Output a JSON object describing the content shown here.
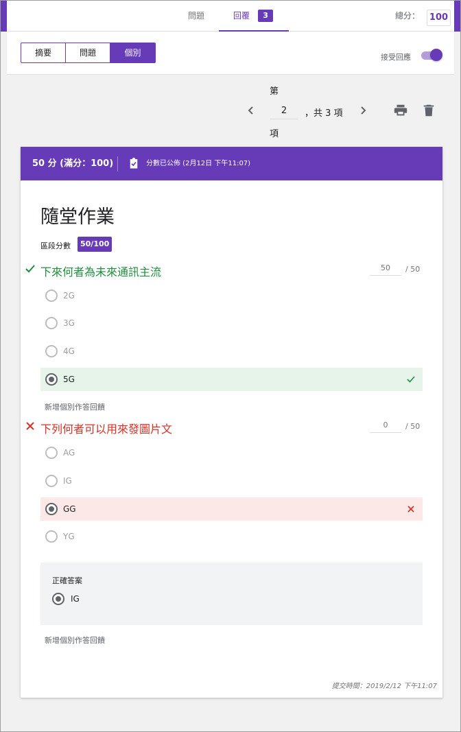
{
  "header": {
    "tabs": [
      {
        "label": "問題"
      },
      {
        "label": "回覆",
        "count": "3"
      }
    ],
    "total_label": "總分：",
    "total_value": "100"
  },
  "controls": {
    "segments": [
      "摘要",
      "問題",
      "個別"
    ],
    "accept_label": "接受回應"
  },
  "pager": {
    "prefix": "第",
    "current": "2",
    "suffix_total": "，共 3 項",
    "suffix": "項"
  },
  "card": {
    "score_text": "50 分 (滿分：100)",
    "published_text": "分數已公佈 (2月12日 下午11:07)",
    "title": "隨堂作業",
    "section_label": "區段分數",
    "section_score": "50/100",
    "questions": [
      {
        "title": "下來何者為未來通訊主流",
        "score": "50",
        "max": "/ 50",
        "options": [
          "2G",
          "3G",
          "4G",
          "5G"
        ],
        "feedback_link": "新增個別作答回饋"
      },
      {
        "title": "下列何者可以用來發圖片文",
        "score": "0",
        "max": "/ 50",
        "options": [
          "AG",
          "IG",
          "GG",
          "YG"
        ],
        "correct_heading": "正確答案",
        "correct_answer": "IG",
        "feedback_link": "新增個別作答回饋"
      }
    ],
    "submit_time": "提交時間：2019/2/12 下午11:07"
  },
  "colors": {
    "accent": "#673ab7",
    "correct": "#1e8e3e",
    "wrong": "#d93025"
  }
}
